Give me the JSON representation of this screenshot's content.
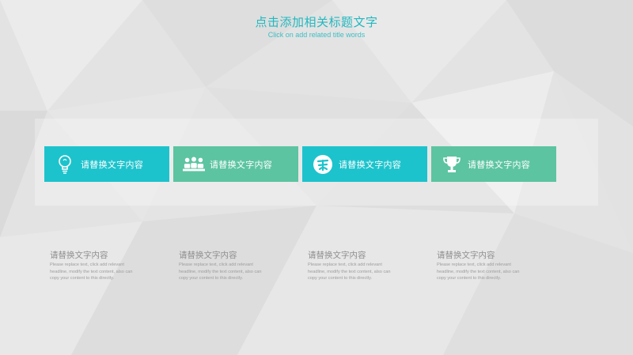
{
  "header": {
    "title": "点击添加相关标题文字",
    "subtitle": "Click on add related title words"
  },
  "colors": {
    "accent_cyan": "#1dc3cc",
    "accent_green": "#5cc4a1",
    "title": "#22b8bf"
  },
  "cards": [
    {
      "label": "请替换文字内容",
      "icon": "lightbulb-icon"
    },
    {
      "label": "请替换文字内容",
      "icon": "meeting-people-icon"
    },
    {
      "label": "请替换文字内容",
      "icon": "badge-icon"
    },
    {
      "label": "请替换文字内容",
      "icon": "trophy-icon"
    }
  ],
  "descriptions": [
    {
      "heading": "请替换文字内容",
      "body": "Please replace text, click add relevant headline, modify the text content, also can copy your content to this directly."
    },
    {
      "heading": "请替换文字内容",
      "body": "Please replace text, click add relevant headline, modify the text content, also can copy your content to this directly."
    },
    {
      "heading": "请替换文字内容",
      "body": "Please replace text, click add relevant headline, modify the text content, also can copy your content to this directly."
    },
    {
      "heading": "请替换文字内容",
      "body": "Please replace text, click add relevant headline, modify the text content, also can copy your content to this directly."
    }
  ]
}
